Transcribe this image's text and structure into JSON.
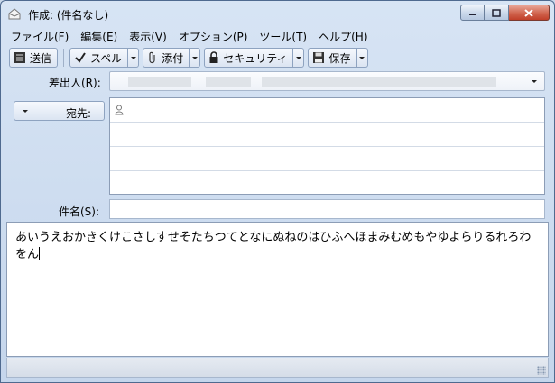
{
  "window": {
    "title": "作成: (件名なし)"
  },
  "menu": [
    {
      "label": "ファイル(F)"
    },
    {
      "label": "編集(E)"
    },
    {
      "label": "表示(V)"
    },
    {
      "label": "オプション(P)"
    },
    {
      "label": "ツール(T)"
    },
    {
      "label": "ヘルプ(H)"
    }
  ],
  "toolbar": {
    "send": "送信",
    "spell": "スペル",
    "attach": "添付",
    "security": "セキュリティ",
    "save": "保存"
  },
  "header": {
    "from_label": "差出人(R):",
    "to_label": "宛先:",
    "subject_label": "件名(S):",
    "subject_value": ""
  },
  "body": {
    "text": "あいうえおかきくけこさしすせそたちつてとなにぬねのはひふへほまみむめもやゆよらりるれろわをん"
  },
  "icons": {
    "app": "compose-icon",
    "send": "send-icon",
    "spell": "checkmark-icon",
    "attach": "paperclip-icon",
    "security": "lock-icon",
    "save": "floppy-icon",
    "recipient": "person-icon"
  }
}
